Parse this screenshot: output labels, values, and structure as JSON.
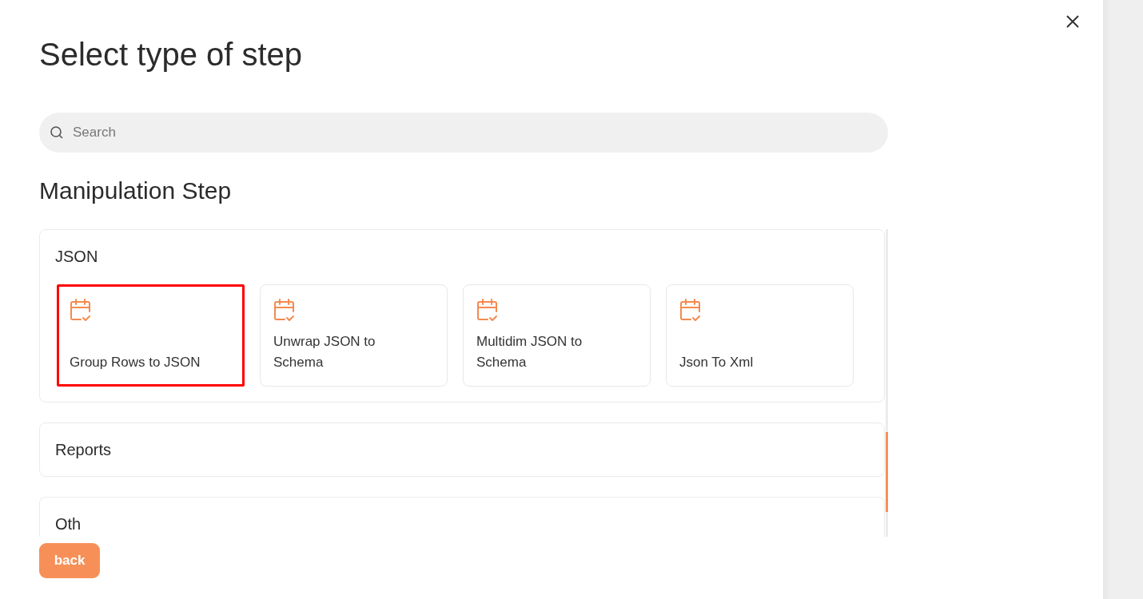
{
  "title": "Select type of step",
  "search": {
    "placeholder": "Search"
  },
  "section_title": "Manipulation Step",
  "groups": [
    {
      "title": "JSON",
      "expanded": true,
      "items": [
        {
          "label": "Group Rows to JSON",
          "selected": true
        },
        {
          "label": "Unwrap JSON to Schema",
          "selected": false
        },
        {
          "label": "Multidim JSON to Schema",
          "selected": false
        },
        {
          "label": "Json To Xml",
          "selected": false
        }
      ]
    },
    {
      "title": "Reports",
      "expanded": false
    },
    {
      "title": "Oth",
      "expanded": false
    }
  ],
  "back_button": "back"
}
